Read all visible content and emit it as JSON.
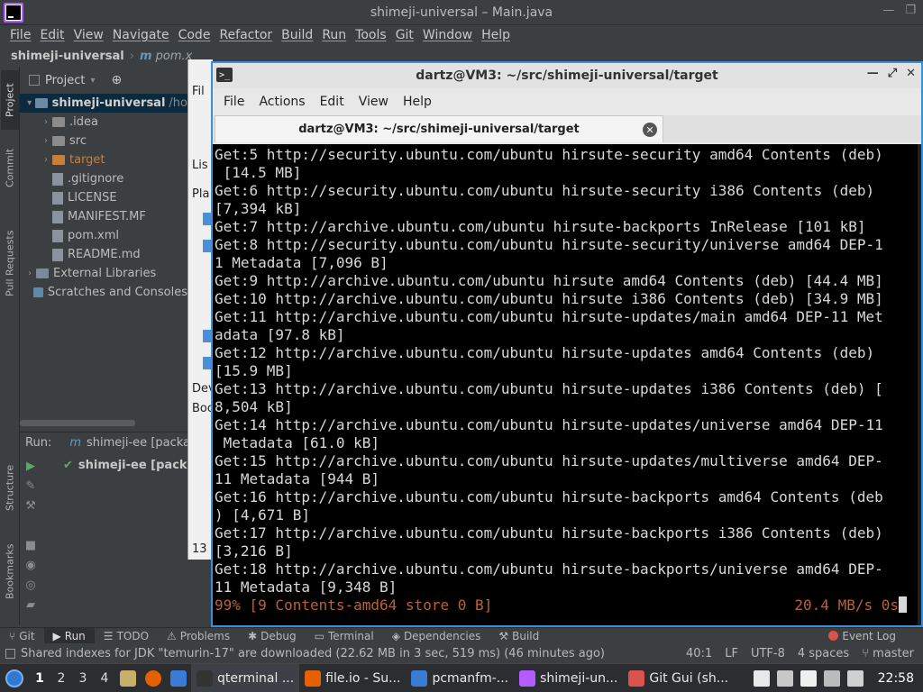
{
  "ide": {
    "title": "shimeji-universal – Main.java",
    "menu": [
      "File",
      "Edit",
      "View",
      "Navigate",
      "Code",
      "Refactor",
      "Build",
      "Run",
      "Tools",
      "Git",
      "Window",
      "Help"
    ],
    "breadcrumb": {
      "project": "shimeji-universal",
      "separator": "›",
      "file": "pom.x"
    },
    "left_tabs": {
      "project": "Project",
      "commit": "Commit",
      "pull_requests": "Pull Requests",
      "structure": "Structure",
      "bookmarks": "Bookmarks"
    },
    "project_panel": {
      "title": "Project",
      "tree": [
        {
          "label": "shimeji-universal",
          "suffix": "/ho",
          "level": 0,
          "chevron": "▾",
          "kind": "folder",
          "color": "#6a8aa8"
        },
        {
          "label": ".idea",
          "level": 1,
          "chevron": "›",
          "kind": "folder",
          "color": "#8c8c8c"
        },
        {
          "label": "src",
          "level": 1,
          "chevron": "›",
          "kind": "folder",
          "color": "#8c8c8c"
        },
        {
          "label": "target",
          "level": 1,
          "chevron": "›",
          "kind": "folder",
          "color": "#c67f3d"
        },
        {
          "label": ".gitignore",
          "level": 1,
          "kind": "file"
        },
        {
          "label": "LICENSE",
          "level": 1,
          "kind": "file"
        },
        {
          "label": "MANIFEST.MF",
          "level": 1,
          "kind": "file"
        },
        {
          "label": "pom.xml",
          "level": 1,
          "kind": "file"
        },
        {
          "label": "README.md",
          "level": 1,
          "kind": "file"
        },
        {
          "label": "External Libraries",
          "level": 0,
          "chevron": "›",
          "kind": "lib"
        },
        {
          "label": "Scratches and Consoles",
          "level": 0,
          "kind": "scratch"
        }
      ]
    },
    "run_panel": {
      "label": "Run:",
      "tab": "shimeji-ee [packa",
      "row": "shimeji-ee [pack"
    },
    "tool_tabs": [
      "Git",
      "Run",
      "TODO",
      "Problems",
      "Debug",
      "Terminal",
      "Dependencies",
      "Build"
    ],
    "event_log": "Event Log",
    "status": {
      "message": "Shared indexes for JDK \"temurin-17\" are downloaded (22.62 MB in 3 sec, 519 ms) (46 minutes ago)",
      "position": "40:1",
      "line_ending": "LF",
      "encoding": "UTF-8",
      "indent": "4 spaces",
      "branch": "master"
    }
  },
  "behind_window": {
    "items": [
      "Fil",
      "Lis",
      "Pla",
      "Dev",
      "Boo",
      "13"
    ]
  },
  "terminal": {
    "title": "dartz@VM3: ~/src/shimeji-universal/target",
    "menu": [
      "File",
      "Actions",
      "Edit",
      "View",
      "Help"
    ],
    "tab_label": "dartz@VM3: ~/src/shimeji-universal/target",
    "lines": [
      "Get:5 http://security.ubuntu.com/ubuntu hirsute-security amd64 Contents (deb)",
      " [14.5 MB]",
      "Get:6 http://security.ubuntu.com/ubuntu hirsute-security i386 Contents (deb)",
      "[7,394 kB]",
      "Get:7 http://archive.ubuntu.com/ubuntu hirsute-backports InRelease [101 kB]",
      "Get:8 http://security.ubuntu.com/ubuntu hirsute-security/universe amd64 DEP-1",
      "1 Metadata [7,096 B]",
      "Get:9 http://archive.ubuntu.com/ubuntu hirsute amd64 Contents (deb) [44.4 MB]",
      "Get:10 http://archive.ubuntu.com/ubuntu hirsute i386 Contents (deb) [34.9 MB]",
      "Get:11 http://archive.ubuntu.com/ubuntu hirsute-updates/main amd64 DEP-11 Met",
      "adata [97.8 kB]",
      "Get:12 http://archive.ubuntu.com/ubuntu hirsute-updates amd64 Contents (deb)",
      "[15.9 MB]",
      "Get:13 http://archive.ubuntu.com/ubuntu hirsute-updates i386 Contents (deb) [",
      "8,504 kB]",
      "Get:14 http://archive.ubuntu.com/ubuntu hirsute-updates/universe amd64 DEP-11",
      " Metadata [61.0 kB]",
      "Get:15 http://archive.ubuntu.com/ubuntu hirsute-updates/multiverse amd64 DEP-",
      "11 Metadata [944 B]",
      "Get:16 http://archive.ubuntu.com/ubuntu hirsute-backports amd64 Contents (deb",
      ") [4,671 B]",
      "Get:17 http://archive.ubuntu.com/ubuntu hirsute-backports i386 Contents (deb)",
      "[3,216 B]",
      "Get:18 http://archive.ubuntu.com/ubuntu hirsute-backports/universe amd64 DEP-",
      "11 Metadata [9,348 B]"
    ],
    "progress_left": "99% [9 Contents-amd64 store 0 B]",
    "progress_right": "20.4 MB/s 0s",
    "colors": {
      "background": "#000000",
      "text": "#d8d8d8",
      "progress": "#b8623a",
      "accent_border": "#3b8fd6"
    }
  },
  "taskbar": {
    "workspaces": [
      "1",
      "2",
      "3",
      "4"
    ],
    "tasks": [
      {
        "label": "qterminal ...",
        "icon": "terminal-icon",
        "color": "#333333"
      },
      {
        "label": "file.io - Su...",
        "icon": "firefox-icon",
        "color": "#e66000"
      },
      {
        "label": "pcmanfm-...",
        "icon": "folder-icon",
        "color": "#3a7bd5"
      },
      {
        "label": "shimeji-un...",
        "icon": "intellij-icon",
        "color": "#b45cff"
      },
      {
        "label": "Git Gui (sh...",
        "icon": "git-gui-icon",
        "color": "#d9534f"
      }
    ],
    "clock": "22:58"
  }
}
